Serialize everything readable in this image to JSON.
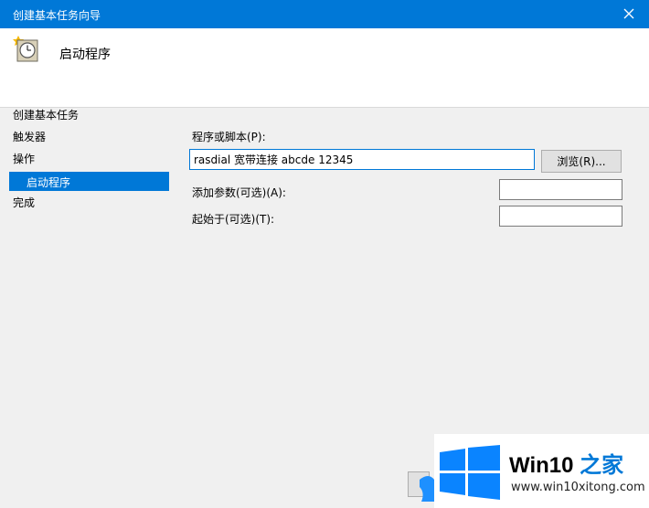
{
  "window": {
    "title": "创建基本任务向导",
    "header_title": "启动程序"
  },
  "nav": {
    "group_label": "创建基本任务",
    "items": [
      {
        "label": "触发器",
        "selected": false
      },
      {
        "label": "操作",
        "selected": false
      },
      {
        "label": "启动程序",
        "selected": true
      },
      {
        "label": "完成",
        "selected": false
      }
    ]
  },
  "form": {
    "program_label": "程序或脚本(P):",
    "program_value": "rasdial 宽带连接 abcde 12345",
    "browse_label": "浏览(R)...",
    "args_label": "添加参数(可选)(A):",
    "args_value": "",
    "start_in_label": "起始于(可选)(T):",
    "start_in_value": ""
  },
  "watermark": {
    "brand_en": "Win10",
    "brand_cn": "之家",
    "url": "www.win10xitong.com"
  },
  "colors": {
    "accent": "#0078d7",
    "dialog_bg": "#f0f0f0",
    "header_bg": "#ffffff"
  },
  "icons": {
    "close": "close-icon",
    "task": "clock-icon",
    "windows_logo": "windows-logo-icon"
  }
}
